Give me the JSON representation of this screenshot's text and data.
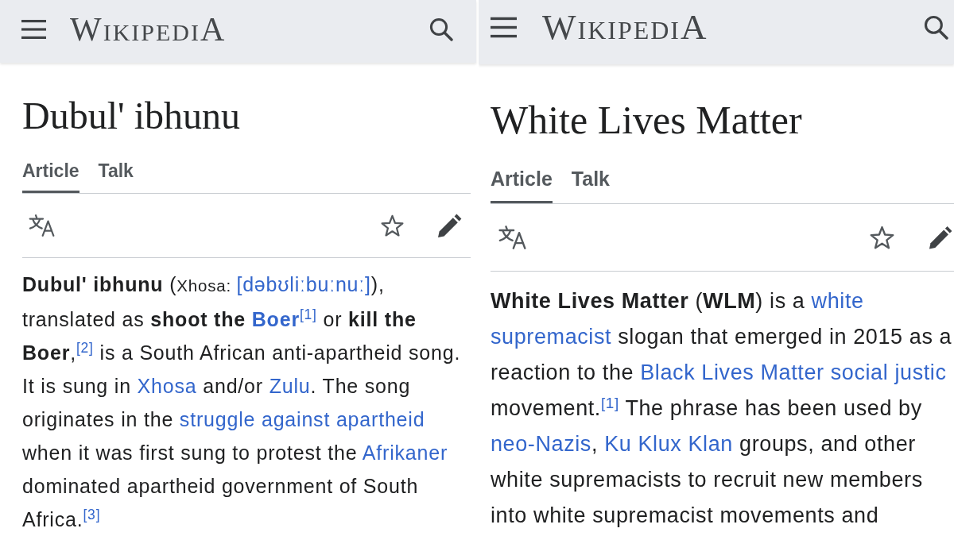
{
  "panels": [
    {
      "header": {
        "logo": "WIKIPEDIA"
      },
      "title": "Dubul' ibhunu",
      "tabs": [
        {
          "label": "Article",
          "selected": true
        },
        {
          "label": "Talk",
          "selected": false
        }
      ],
      "lead": [
        [
          {
            "kind": "text",
            "text": "**Dubul' ibhunu** ("
          },
          {
            "kind": "small",
            "text": "Xhosa: "
          },
          {
            "kind": "link",
            "text": "[dəbʊliːbuːnuː]"
          },
          {
            "kind": "text",
            "text": "),"
          }
        ],
        [
          {
            "kind": "text",
            "text": "translated as **shoot the** "
          },
          {
            "kind": "link",
            "text": "**Boer**"
          },
          {
            "kind": "ref",
            "text": "[1]"
          },
          {
            "kind": "text",
            "text": " or **kill the**"
          }
        ],
        [
          {
            "kind": "text",
            "text": "**Boer**,"
          },
          {
            "kind": "ref",
            "text": "[2]"
          },
          {
            "kind": "text",
            "text": " is a South African anti-apartheid song."
          }
        ],
        [
          {
            "kind": "text",
            "text": "It is sung in "
          },
          {
            "kind": "link",
            "text": "Xhosa"
          },
          {
            "kind": "text",
            "text": " and/or "
          },
          {
            "kind": "link",
            "text": "Zulu"
          },
          {
            "kind": "text",
            "text": ". The song"
          }
        ],
        [
          {
            "kind": "text",
            "text": "originates in the "
          },
          {
            "kind": "link",
            "text": "struggle against apartheid"
          }
        ],
        [
          {
            "kind": "text",
            "text": "when it was first sung to protest the "
          },
          {
            "kind": "link",
            "text": "Afrikaner"
          }
        ],
        [
          {
            "kind": "text",
            "text": "dominated apartheid government of South"
          }
        ],
        [
          {
            "kind": "text",
            "text": "Africa."
          },
          {
            "kind": "ref",
            "text": "[3]"
          }
        ]
      ]
    },
    {
      "header": {
        "logo": "WIKIPEDIA"
      },
      "title": "White Lives Matter",
      "tabs": [
        {
          "label": "Article",
          "selected": true
        },
        {
          "label": "Talk",
          "selected": false
        }
      ],
      "lead": [
        [
          {
            "kind": "text",
            "text": "**White Lives Matter** (**WLM**) is a "
          },
          {
            "kind": "link",
            "text": "white"
          }
        ],
        [
          {
            "kind": "link",
            "text": "supremacist"
          },
          {
            "kind": "text",
            "text": " slogan that emerged in 2015 as a"
          }
        ],
        [
          {
            "kind": "text",
            "text": "reaction to the "
          },
          {
            "kind": "link",
            "text": "Black Lives Matter social justic"
          }
        ],
        [
          {
            "kind": "text",
            "text": "movement."
          },
          {
            "kind": "ref",
            "text": "[1]"
          },
          {
            "kind": "text",
            "text": " The phrase has been used by"
          }
        ],
        [
          {
            "kind": "link",
            "text": "neo-Nazis",
            "after": ", "
          },
          {
            "kind": "link",
            "text": "Ku Klux Klan"
          },
          {
            "kind": "text",
            "text": " groups, and other"
          }
        ],
        [
          {
            "kind": "text",
            "text": "white supremacists to recruit new members"
          }
        ],
        [
          {
            "kind": "text",
            "text": "into white supremacist movements and"
          }
        ]
      ]
    }
  ]
}
